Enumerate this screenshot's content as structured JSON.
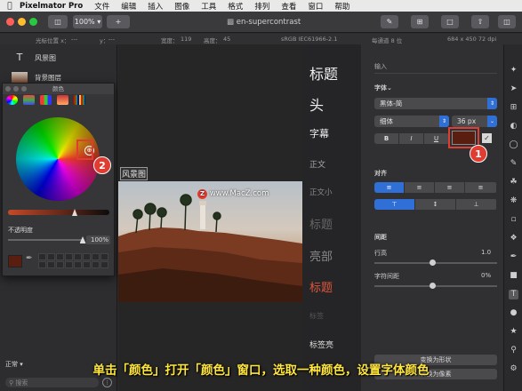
{
  "menubar": {
    "app_name": "Pixelmator Pro",
    "items": [
      "文件",
      "编辑",
      "插入",
      "图像",
      "工具",
      "格式",
      "排列",
      "查看",
      "窗口",
      "帮助"
    ]
  },
  "toolbar": {
    "zoom": "100%",
    "add_label": "+",
    "document_title": "en-supercontrast"
  },
  "infobar": {
    "cursor_label": "光标位置 x：",
    "cursor_x": "---",
    "cursor_y_label": "y：",
    "cursor_y": "---",
    "width_label": "宽度：",
    "width": "119",
    "height_label": "高度：",
    "height": "45",
    "color_profile": "sRGB IEC61966-2.1",
    "bit_depth": "每通道 8 位",
    "image_size": "684 x 450 72 dpi"
  },
  "layers": {
    "items": [
      {
        "label": "风景图",
        "kind": "text"
      },
      {
        "label": "背景图层",
        "kind": "image"
      }
    ],
    "blend_mode": "正常",
    "search_placeholder": "搜索"
  },
  "color_window": {
    "title": "颜色",
    "opacity_label": "不透明度",
    "opacity_value": "100%",
    "opacity": 1.0,
    "picked_color": "#5a1e10"
  },
  "canvas": {
    "text_layer_label": "风景图",
    "watermark": "www.MacZ.com"
  },
  "presets": {
    "items": [
      "标题",
      "头",
      "字幕",
      "正文",
      "正文小",
      "标题",
      "亮部",
      "标题",
      "标签",
      "标签亮"
    ]
  },
  "inspector": {
    "input_label": "输入",
    "font_section": "字体",
    "font_family": "黑体-简",
    "font_weight": "细体",
    "font_size": "36 px",
    "style_buttons": [
      "B",
      "I",
      "U"
    ],
    "text_color": "#5a1e10",
    "align_section": "对齐",
    "spacing_section": "间距",
    "line_height_label": "行高",
    "line_height_value": "1.0",
    "char_spacing_label": "字符间距",
    "char_spacing_value": "0%",
    "convert_shape_label": "变换为形状",
    "convert_pixels_label": "转换为像素"
  },
  "callouts": {
    "one": "1",
    "two": "2"
  },
  "instruction": "单击「颜色」打开「颜色」窗口，选取一种颜色，设置字体颜色",
  "colors": {
    "accent": "#2f6fd6",
    "callout": "#e03c31",
    "banner_text": "#ffe640"
  }
}
